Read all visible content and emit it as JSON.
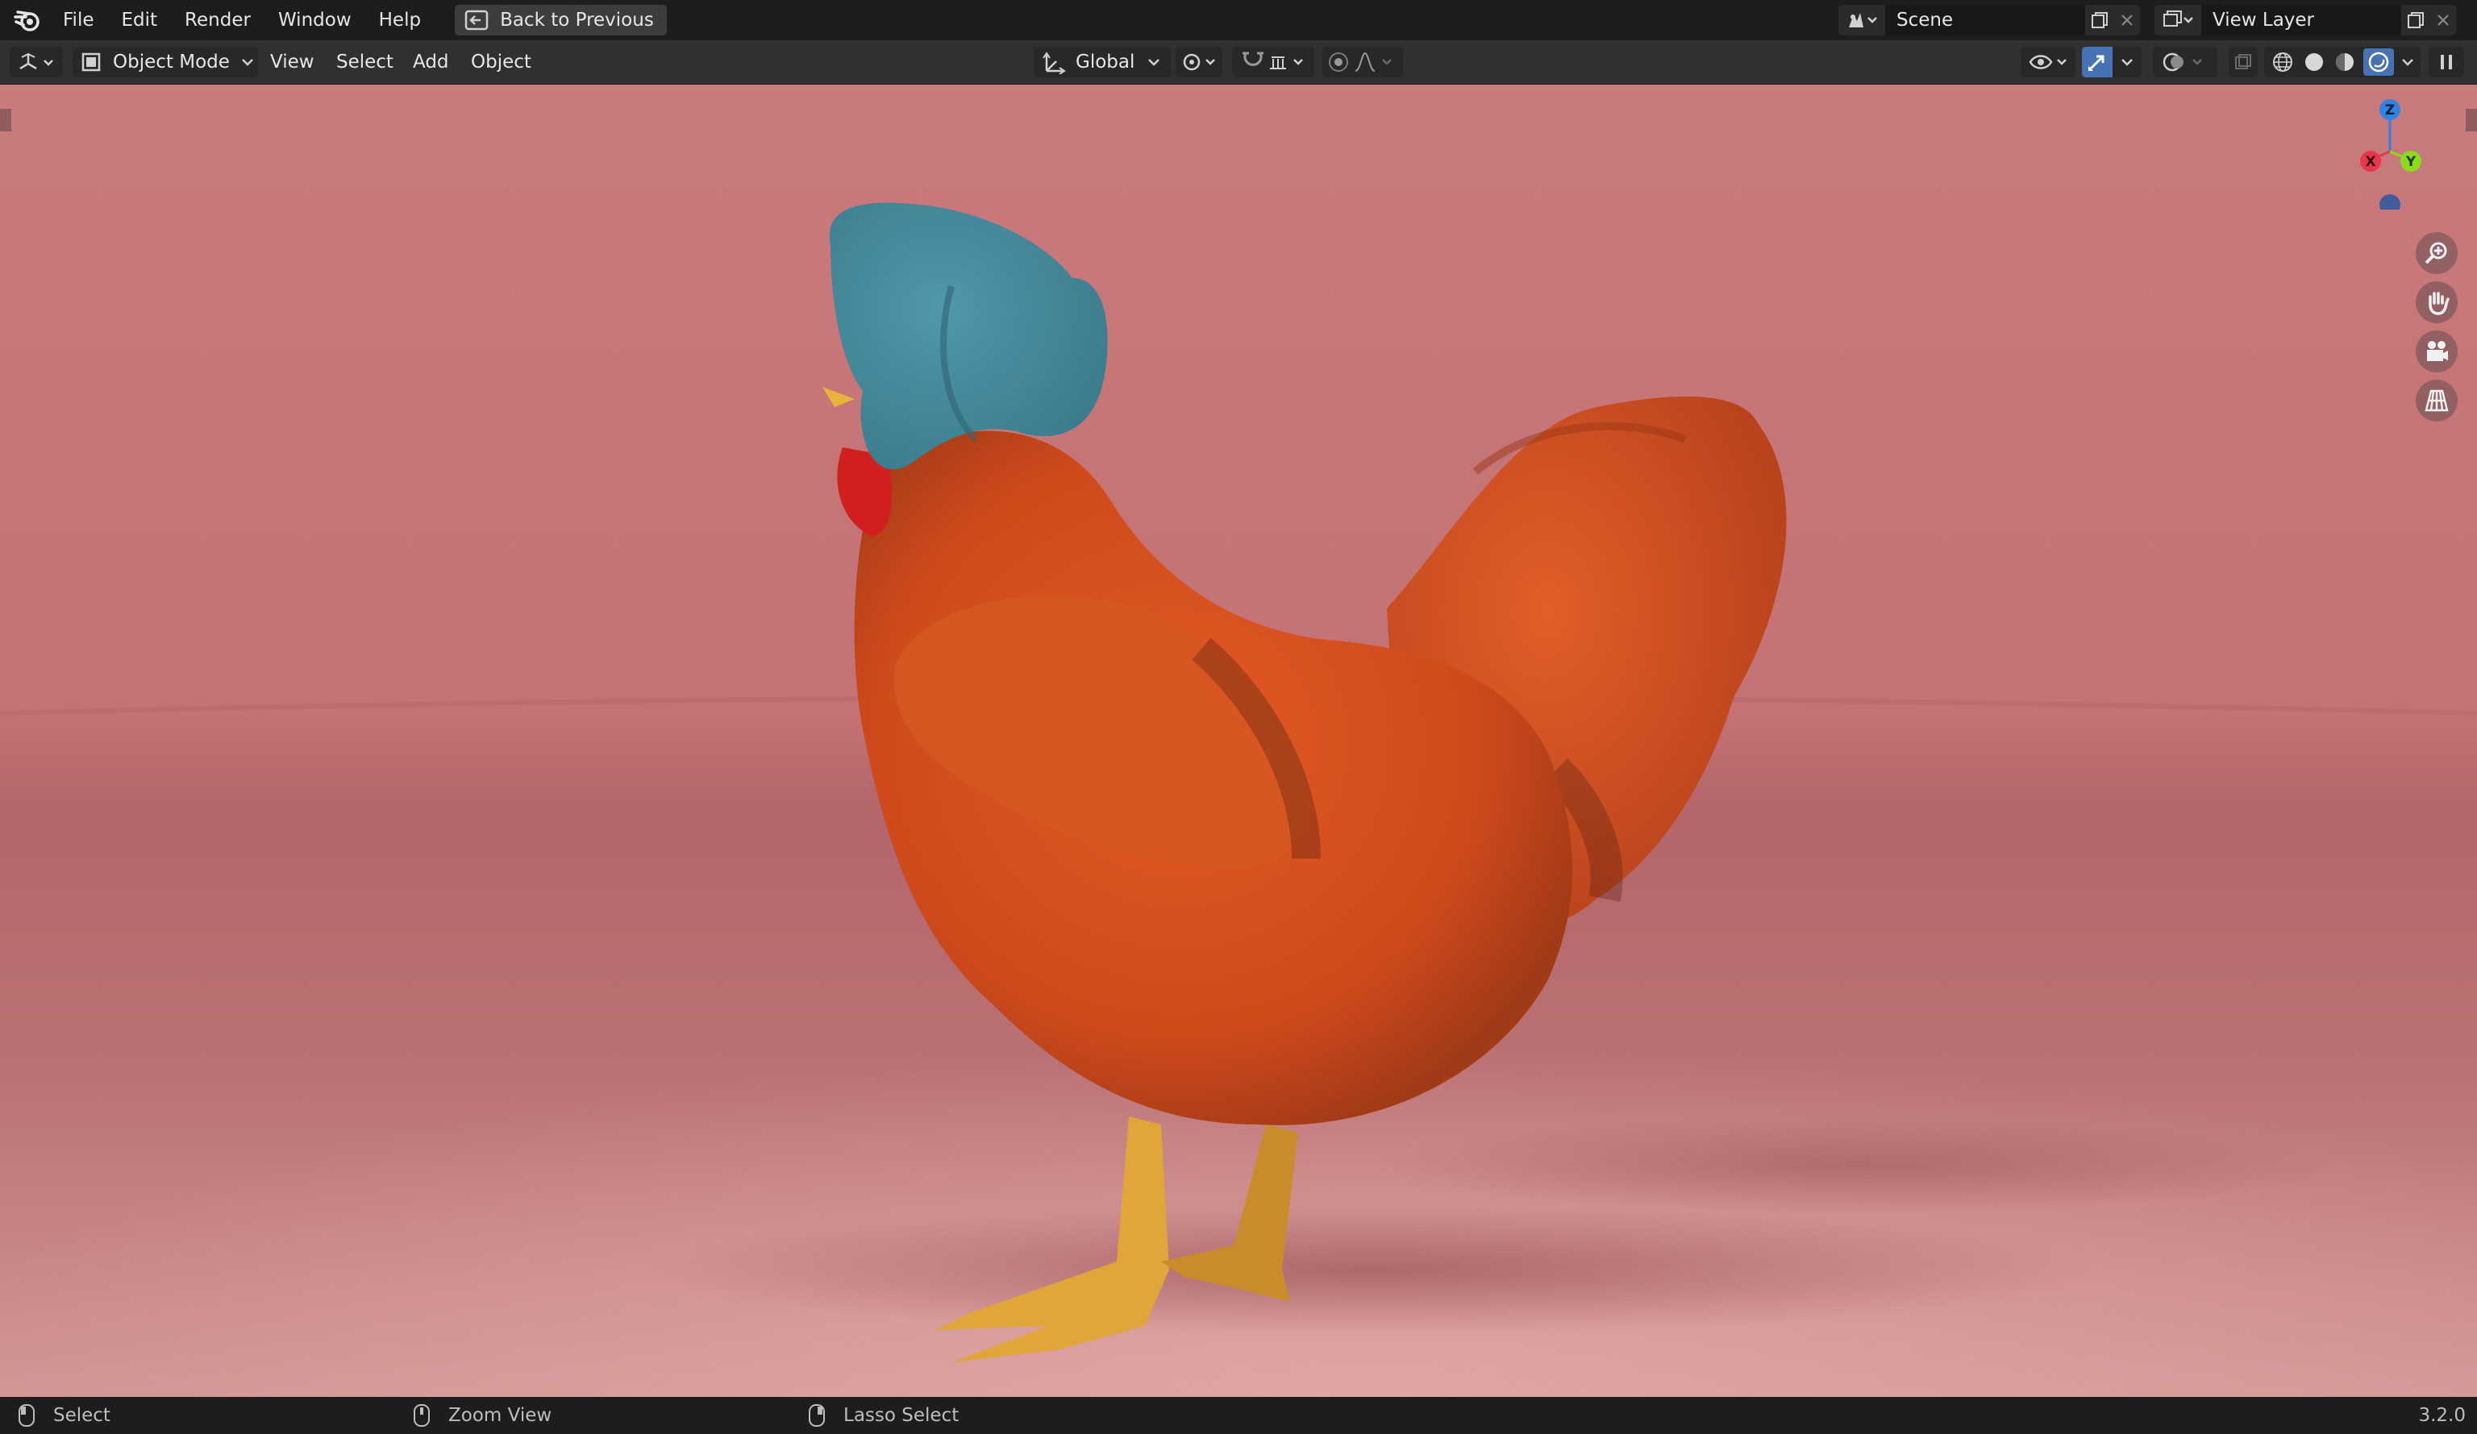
{
  "menubar": {
    "items": [
      {
        "key": "file",
        "label": "File"
      },
      {
        "key": "edit",
        "label": "Edit"
      },
      {
        "key": "render",
        "label": "Render"
      },
      {
        "key": "window",
        "label": "Window"
      },
      {
        "key": "help",
        "label": "Help"
      }
    ],
    "back_button": "Back to Previous",
    "scene_name": "Scene",
    "view_layer_name": "View Layer"
  },
  "header": {
    "mode": "Object Mode",
    "menus": [
      "View",
      "Select",
      "Add",
      "Object"
    ],
    "transform_orientation": "Global"
  },
  "gizmo": {
    "x_label": "X",
    "y_label": "Y",
    "z_label": "Z"
  },
  "status": {
    "hint_left": "Select",
    "hint_middle": "Zoom View",
    "hint_right": "Lasso Select",
    "version": "3.2.0"
  },
  "colors": {
    "axis_x": "#e8364e",
    "axis_y": "#8bdb1a",
    "axis_z": "#2f83e3",
    "active_accent": "#4772b3",
    "viewport_bg": "#c47274"
  }
}
